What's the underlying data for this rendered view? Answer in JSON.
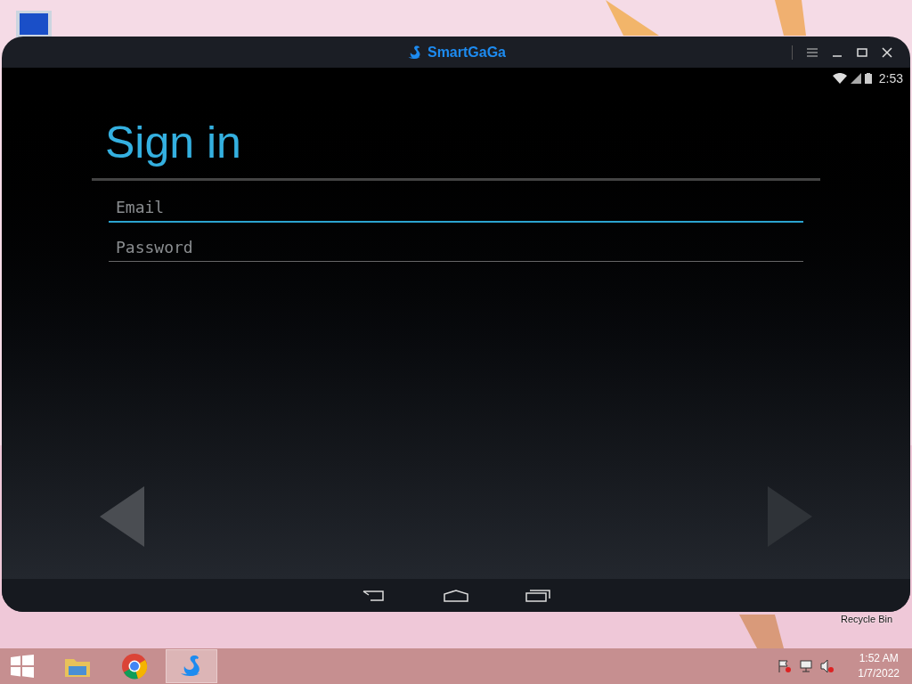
{
  "window": {
    "title": "SmartGaGa"
  },
  "status_bar": {
    "time": "2:53"
  },
  "page": {
    "title": "Sign in"
  },
  "fields": [
    {
      "placeholder": "Email",
      "focused": true
    },
    {
      "placeholder": "Password",
      "focused": false
    }
  ],
  "desktop": {
    "recycle_bin_label": "Recycle Bin"
  },
  "taskbar": {
    "apps": [
      {
        "kind": "folder",
        "selected": false
      },
      {
        "kind": "browser",
        "selected": false
      },
      {
        "kind": "swan",
        "selected": true
      }
    ],
    "time": "1:52 AM",
    "date": "1/7/2022"
  }
}
